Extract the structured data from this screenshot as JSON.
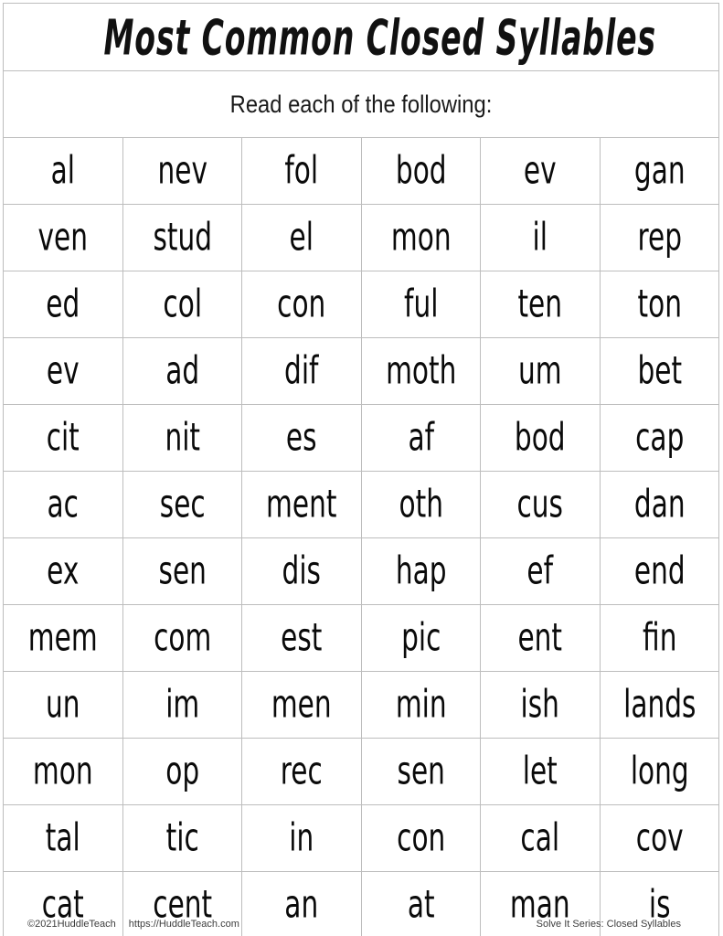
{
  "page": {
    "title": "Most Common Closed Syllables",
    "instruction": "Read each of the following:",
    "background_color": "#ffffff",
    "grid_line_color": "#bdbdbd",
    "text_color": "#0a0a0a"
  },
  "table": {
    "columns": 6,
    "rows": 12,
    "cells": [
      [
        "al",
        "nev",
        "fol",
        "bod",
        "ev",
        "gan"
      ],
      [
        "ven",
        "stud",
        "el",
        "mon",
        "il",
        "rep"
      ],
      [
        "ed",
        "col",
        "con",
        "ful",
        "ten",
        "ton"
      ],
      [
        "ev",
        "ad",
        "dif",
        "moth",
        "um",
        "bet"
      ],
      [
        "cit",
        "nit",
        "es",
        "af",
        "bod",
        "cap"
      ],
      [
        "ac",
        "sec",
        "ment",
        "oth",
        "cus",
        "dan"
      ],
      [
        "ex",
        "sen",
        "dis",
        "hap",
        "ef",
        "end"
      ],
      [
        "mem",
        "com",
        "est",
        "pic",
        "ent",
        "fin"
      ],
      [
        "un",
        "im",
        "men",
        "min",
        "ish",
        "lands"
      ],
      [
        "mon",
        "op",
        "rec",
        "sen",
        "let",
        "long"
      ],
      [
        "tal",
        "tic",
        "in",
        "con",
        "cal",
        "cov"
      ],
      [
        "cat",
        "cent",
        "an",
        "at",
        "man",
        "is"
      ]
    ]
  },
  "footer": {
    "copyright": "©2021HuddleTeach",
    "url": "https://HuddleTeach.com",
    "series": "Solve It Series: Closed Syllables"
  }
}
